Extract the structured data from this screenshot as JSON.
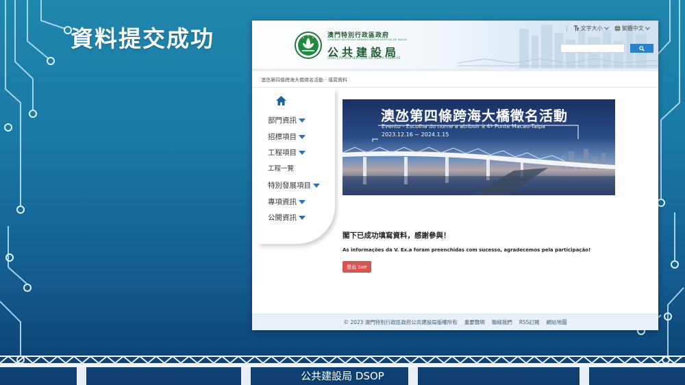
{
  "slide": {
    "title": "資料提交成功",
    "caption": "公共建設局 DSOP"
  },
  "header": {
    "gov_name": "澳門特別行政區政府",
    "gov_sub": "GOVERNO DA REGIÃO ADMINISTRATIVA ESPECIAL DE MACAU",
    "dept_name": "公共建設局",
    "dept_sub": "DIRECÇÃO DOS SERVIÇOS DE OBRAS PÚBLICAS",
    "font_size_label": "文字大小",
    "language_label": "繁體中文",
    "search_placeholder": ""
  },
  "breadcrumb": "澳氹第四條跨海大橋徵名活動 - 填寫資料",
  "nav": {
    "items": [
      "部門資訊",
      "招標項目",
      "工程項目",
      "工程一覽",
      "特別發展項目",
      "專項資訊",
      "公開資訊"
    ]
  },
  "banner": {
    "title": "澳氹第四條跨海大橋徵名活動",
    "subtitle": "Evento - Escolha do nome a atribuir à 4ª Ponte Macau-Taipa",
    "dates": "2023.12.16 ~ 2024.1.15"
  },
  "message": {
    "zh": "閣下已成功填寫資料，感謝參與！",
    "pt": "As informações da V. Ex.a foram preenchidas com sucesso, agradecemos pela participação!",
    "exit_button": "登出 Sair"
  },
  "footer": {
    "copyright": "© 2023 澳門特別行政區政府公共建設局版權所有",
    "links": [
      "重要聲明",
      "聯絡我們",
      "RSS訂閱",
      "網站地圖"
    ]
  },
  "colors": {
    "slide_bg_top": "#1f86ad",
    "slide_bg_bottom": "#0d3d6e",
    "brand_green": "#1b5b2d",
    "search_button": "#2b82c9",
    "exit_button": "#d9534f",
    "nav_caret": "#2a6fb4"
  },
  "icons": {
    "home": "home-icon",
    "search": "search-icon",
    "font_size": "text-size-icon",
    "language": "globe-icon",
    "caret": "caret-down-icon"
  }
}
